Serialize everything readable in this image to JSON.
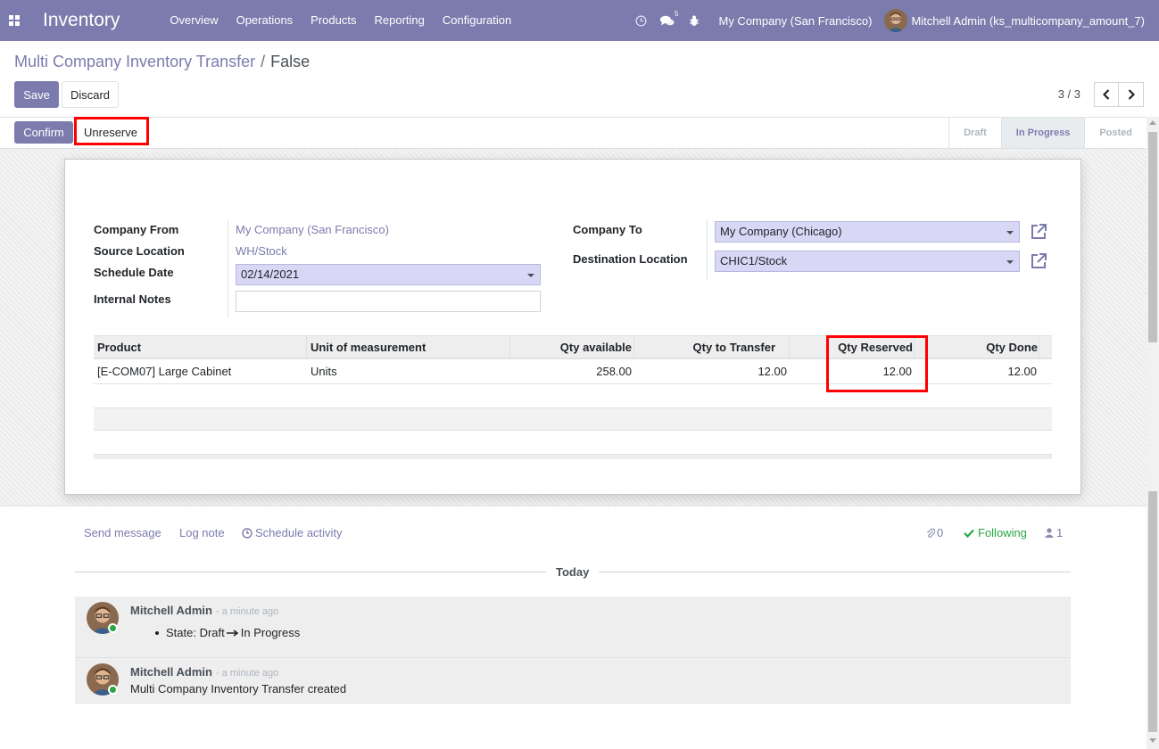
{
  "navbar": {
    "brand": "Inventory",
    "menu": [
      {
        "label": "Overview"
      },
      {
        "label": "Operations"
      },
      {
        "label": "Products"
      },
      {
        "label": "Reporting"
      },
      {
        "label": "Configuration"
      }
    ],
    "messages_badge": "5",
    "company": "My Company (San Francisco)",
    "user": "Mitchell Admin (ks_multicompany_amount_7)"
  },
  "breadcrumb": {
    "parent": "Multi Company Inventory Transfer",
    "separator": "/",
    "current": "False"
  },
  "actions": {
    "save": "Save",
    "discard": "Discard"
  },
  "pager": {
    "value": "3 / 3"
  },
  "statusbar": {
    "confirm": "Confirm",
    "unreserve": "Unreserve",
    "stages": [
      {
        "label": "Draft",
        "active": false
      },
      {
        "label": "In Progress",
        "active": true
      },
      {
        "label": "Posted",
        "active": false
      }
    ]
  },
  "form": {
    "company_from_label": "Company From",
    "company_from_value": "My Company (San Francisco)",
    "source_location_label": "Source Location",
    "source_location_value": "WH/Stock",
    "schedule_date_label": "Schedule Date",
    "schedule_date_value": "02/14/2021",
    "internal_notes_label": "Internal Notes",
    "internal_notes_value": "",
    "company_to_label": "Company To",
    "company_to_value": "My Company (Chicago)",
    "destination_location_label": "Destination Location",
    "destination_location_value": "CHIC1/Stock"
  },
  "table": {
    "columns": [
      "Product",
      "Unit of measurement",
      "Qty available",
      "Qty to Transfer",
      "Qty Reserved",
      "Qty Done"
    ],
    "rows": [
      [
        "[E-COM07] Large Cabinet",
        "Units",
        "258.00",
        "12.00",
        "12.00",
        "12.00"
      ]
    ]
  },
  "chatter": {
    "send_message": "Send message",
    "log_note": "Log note",
    "schedule_activity": "Schedule activity",
    "attachments": "0",
    "following": "Following",
    "followers": "1",
    "date_separator": "Today",
    "messages": [
      {
        "author": "Mitchell Admin",
        "time": "- a minute ago",
        "from": "State: Draft",
        "to": "In Progress"
      },
      {
        "author": "Mitchell Admin",
        "time": "- a minute ago",
        "body": "Multi Company Inventory Transfer created"
      }
    ]
  },
  "colors": {
    "brand": "#7c7bad",
    "highlight": "#ff0000",
    "select_bg": "#d8d8f6",
    "following": "#28a745"
  }
}
